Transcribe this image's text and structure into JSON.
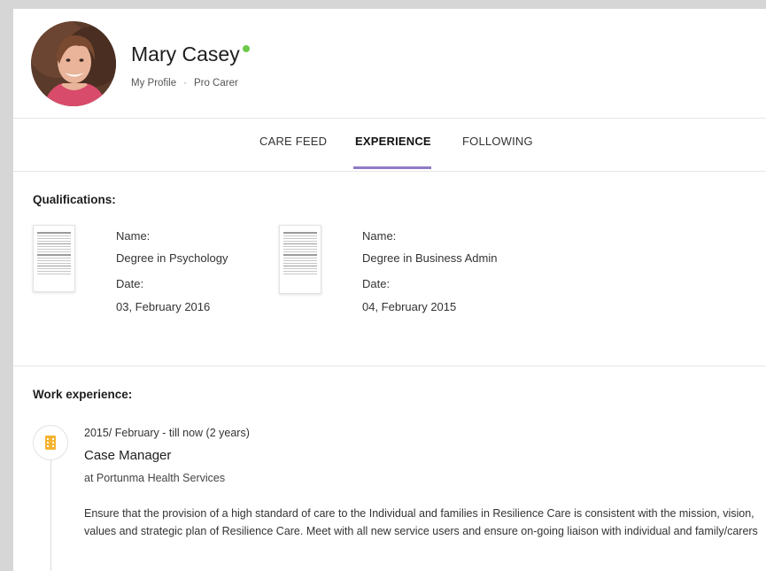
{
  "profile": {
    "name": "Mary Casey",
    "online_status_color": "#6dc94a",
    "links": [
      "My Profile",
      "Pro Carer"
    ],
    "separator": "·",
    "avatar": "profile-photo"
  },
  "tabs": [
    {
      "label": "CARE FEED",
      "active": false
    },
    {
      "label": "EXPERIENCE",
      "active": true
    },
    {
      "label": "FOLLOWING",
      "active": false
    }
  ],
  "accent_color": "#8e7bc4",
  "qualifications": {
    "title": "Qualifications:",
    "items": [
      {
        "name_label": "Name:",
        "name": "Degree in Psychology",
        "date_label": "Date:",
        "date": "03, February 2016"
      },
      {
        "name_label": "Name:",
        "name": "Degree in Business Admin",
        "date_label": "Date:",
        "date": "04, February 2015"
      }
    ]
  },
  "work_experience": {
    "title": "Work experience:",
    "items": [
      {
        "icon": "building-icon",
        "period": "2015/ February - till now (2 years)",
        "role": "Case Manager",
        "company": "at Portunma Health Services",
        "description": "Ensure that the provision of a high standard of care to the Individual and families in Resilience Care is consistent with the mission, vision, values and strategic plan of Resilience Care. Meet with all new service users and ensure on-going liaison with individual and family/carers"
      }
    ]
  }
}
